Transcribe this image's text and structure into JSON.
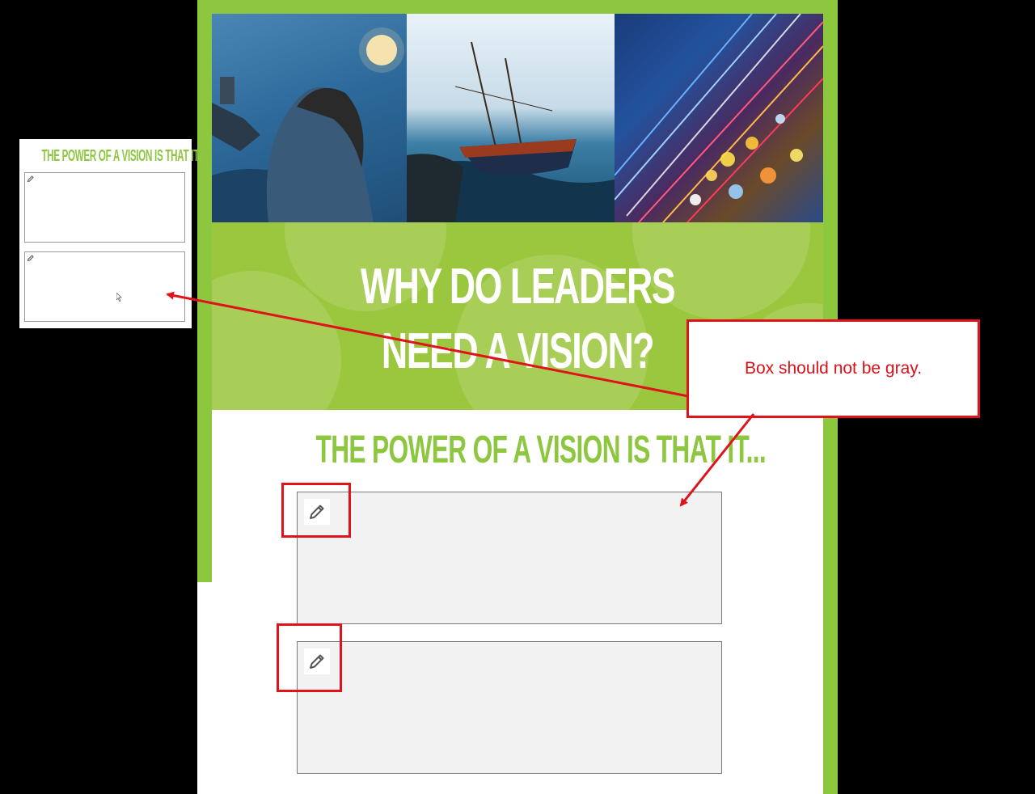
{
  "hero": {
    "photos": [
      {
        "name": "woman-with-telescope-photo"
      },
      {
        "name": "sailboat-photo"
      },
      {
        "name": "light-trails-photo"
      }
    ]
  },
  "banner": {
    "title_line1": "WHY DO LEADERS",
    "title_line2": "NEED A VISION?"
  },
  "content": {
    "subtitle": "THE POWER OF A VISION IS THAT IT...",
    "boxes": [
      {
        "icon": "pencil-icon"
      },
      {
        "icon": "pencil-icon"
      }
    ]
  },
  "thumbnail": {
    "subtitle": "THE POWER OF A VISION IS THAT IT..."
  },
  "annotation": {
    "callout_text": "Box should not be gray."
  },
  "colors": {
    "brand_green": "#8dc63f",
    "banner_green": "#9bc73f",
    "box_gray": "#f2f2f2",
    "annotation_red": "#e0121a"
  }
}
